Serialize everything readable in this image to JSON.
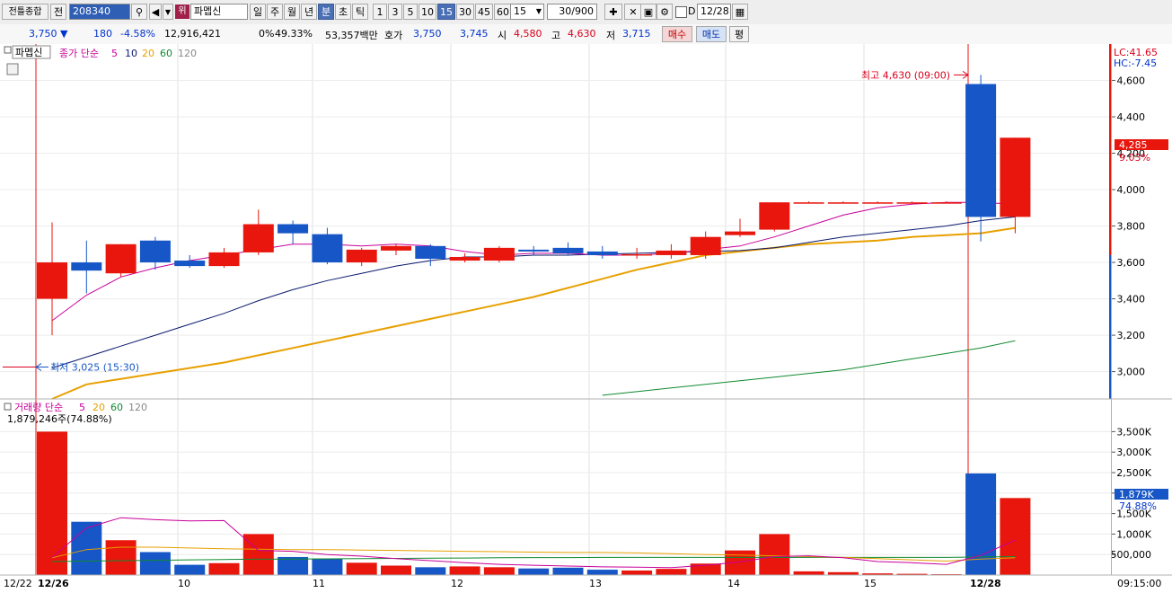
{
  "toolbar": {
    "screen_title": "전틀종합",
    "prev_label": "전",
    "code": "208340",
    "badge": "위",
    "name": "파멥신",
    "periods": [
      "일",
      "주",
      "월",
      "년",
      "분",
      "초",
      "틱"
    ],
    "active_period": "분",
    "intervals": [
      "1",
      "3",
      "5",
      "10",
      "15",
      "30",
      "45",
      "60"
    ],
    "active_interval": "15",
    "interval_select": "15",
    "count": "30/900",
    "checkbox_label": "D",
    "date": "12/28"
  },
  "quote": {
    "price": "3,750",
    "change": "180",
    "change_pct": "-4.58%",
    "volume": "12,916,421",
    "vol_ratio": "0%",
    "turnover_pct": "49.33%",
    "amount": "53,357백만",
    "hoga_label": "호가",
    "ask": "3,750",
    "bid": "3,745",
    "open_label": "시",
    "open": "4,580",
    "high_label": "고",
    "high": "4,630",
    "low_label": "저",
    "low": "3,715",
    "buy_label": "매수",
    "sell_label": "매도",
    "avg_label": "평"
  },
  "price_panel": {
    "name_tag": "파멥신",
    "legend": {
      "prefix": "종가 단순",
      "ma": [
        "5",
        "10",
        "20",
        "60",
        "120"
      ]
    },
    "lc": "LC:41.65",
    "hc": "HC:-7.45",
    "high_marker": "최고 4,630 (09:00)",
    "low_marker": "최저 3,025 (15:30)",
    "current_price": "4,285",
    "current_pct": "9.03%"
  },
  "volume_panel": {
    "legend": {
      "prefix": "거래량 단순",
      "ma": [
        "5",
        "20",
        "60",
        "120"
      ]
    },
    "current_volume": "1,879,246주(74.88%)",
    "current_tag": "1,879K",
    "current_pct": "74.88%"
  },
  "time_axis": {
    "first": "12/22",
    "clock": "09:15:00"
  },
  "colors": {
    "up": "#e8160c",
    "down": "#1656c6",
    "ma5": "#c8009a",
    "ma10": "#0a1a6e",
    "ma20": "#e8a000",
    "ma60": "#108a30"
  },
  "chart_data": {
    "type": "candlestick",
    "y_ticks": [
      "4,600",
      "4,400",
      "4,200",
      "4,000",
      "3,800",
      "3,600",
      "3,400",
      "3,200",
      "3,000"
    ],
    "ylim": [
      2850,
      4780
    ],
    "volume_ticks": [
      "3,500K",
      "3,000K",
      "2,500K",
      "2,000K",
      "1,500K",
      "1,000K",
      "500,000"
    ],
    "volume_ylim": [
      0,
      3750
    ],
    "x_labels": [
      "12/26",
      "10",
      "11",
      "12",
      "13",
      "14",
      "15",
      "12/28"
    ],
    "candles": [
      {
        "o": 3400,
        "h": 3820,
        "l": 3200,
        "c": 3600,
        "v": 3500
      },
      {
        "o": 3600,
        "h": 3720,
        "l": 3430,
        "c": 3555,
        "v": 1300
      },
      {
        "o": 3540,
        "h": 3700,
        "l": 3520,
        "c": 3700,
        "v": 850
      },
      {
        "o": 3720,
        "h": 3740,
        "l": 3560,
        "c": 3600,
        "v": 560
      },
      {
        "o": 3610,
        "h": 3640,
        "l": 3570,
        "c": 3580,
        "v": 250
      },
      {
        "o": 3580,
        "h": 3680,
        "l": 3570,
        "c": 3655,
        "v": 290
      },
      {
        "o": 3655,
        "h": 3890,
        "l": 3640,
        "c": 3810,
        "v": 1000
      },
      {
        "o": 3810,
        "h": 3830,
        "l": 3700,
        "c": 3760,
        "v": 440
      },
      {
        "o": 3755,
        "h": 3790,
        "l": 3590,
        "c": 3600,
        "v": 400
      },
      {
        "o": 3600,
        "h": 3680,
        "l": 3580,
        "c": 3670,
        "v": 300
      },
      {
        "o": 3665,
        "h": 3700,
        "l": 3640,
        "c": 3690,
        "v": 230
      },
      {
        "o": 3690,
        "h": 3700,
        "l": 3580,
        "c": 3620,
        "v": 190
      },
      {
        "o": 3610,
        "h": 3650,
        "l": 3600,
        "c": 3630,
        "v": 210
      },
      {
        "o": 3610,
        "h": 3690,
        "l": 3600,
        "c": 3680,
        "v": 190
      },
      {
        "o": 3670,
        "h": 3690,
        "l": 3640,
        "c": 3660,
        "v": 160
      },
      {
        "o": 3680,
        "h": 3710,
        "l": 3640,
        "c": 3650,
        "v": 180
      },
      {
        "o": 3660,
        "h": 3690,
        "l": 3620,
        "c": 3640,
        "v": 130
      },
      {
        "o": 3640,
        "h": 3680,
        "l": 3620,
        "c": 3645,
        "v": 110
      },
      {
        "o": 3640,
        "h": 3700,
        "l": 3620,
        "c": 3665,
        "v": 150
      },
      {
        "o": 3640,
        "h": 3770,
        "l": 3620,
        "c": 3740,
        "v": 280
      },
      {
        "o": 3750,
        "h": 3840,
        "l": 3740,
        "c": 3770,
        "v": 600
      },
      {
        "o": 3780,
        "h": 3930,
        "l": 3770,
        "c": 3930,
        "v": 1000
      },
      {
        "o": 3930,
        "h": 3935,
        "l": 3925,
        "c": 3930,
        "v": 90
      },
      {
        "o": 3930,
        "h": 3935,
        "l": 3925,
        "c": 3930,
        "v": 70
      },
      {
        "o": 3930,
        "h": 3935,
        "l": 3925,
        "c": 3930,
        "v": 40
      },
      {
        "o": 3930,
        "h": 3935,
        "l": 3925,
        "c": 3930,
        "v": 30
      },
      {
        "o": 3930,
        "h": 3935,
        "l": 3925,
        "c": 3930,
        "v": 20
      },
      {
        "o": 4580,
        "h": 4630,
        "l": 3715,
        "c": 3850,
        "v": 2480
      },
      {
        "o": 3850,
        "h": 4285,
        "l": 3760,
        "c": 4285,
        "v": 1879
      }
    ],
    "ma5": [
      3280,
      3420,
      3520,
      3570,
      3610,
      3640,
      3670,
      3700,
      3700,
      3690,
      3700,
      3690,
      3660,
      3640,
      3650,
      3650,
      3640,
      3640,
      3650,
      3670,
      3690,
      3740,
      3800,
      3860,
      3900,
      3920,
      3930,
      3930,
      3920
    ],
    "ma10": [
      3020,
      3080,
      3140,
      3200,
      3260,
      3320,
      3390,
      3450,
      3500,
      3540,
      3580,
      3610,
      3630,
      3630,
      3640,
      3640,
      3645,
      3650,
      3655,
      3660,
      3665,
      3680,
      3710,
      3740,
      3760,
      3780,
      3800,
      3830,
      3850
    ],
    "ma20": [
      2850,
      2930,
      2960,
      2990,
      3020,
      3050,
      3090,
      3130,
      3170,
      3210,
      3250,
      3290,
      3330,
      3370,
      3410,
      3460,
      3510,
      3560,
      3600,
      3640,
      3660,
      3680,
      3700,
      3710,
      3720,
      3740,
      3750,
      3760,
      3790
    ],
    "ma60": [
      null,
      null,
      null,
      null,
      null,
      null,
      null,
      null,
      null,
      null,
      null,
      null,
      null,
      null,
      null,
      null,
      2870,
      2890,
      2910,
      2930,
      2950,
      2970,
      2990,
      3010,
      3040,
      3070,
      3100,
      3130,
      3170
    ],
    "vol_ma5": [
      430,
      1150,
      1400,
      1350,
      1320,
      1330,
      600,
      580,
      500,
      460,
      400,
      350,
      300,
      260,
      240,
      220,
      200,
      190,
      180,
      240,
      320,
      450,
      470,
      420,
      330,
      300,
      260,
      480,
      850
    ],
    "vol_ma20": [
      420,
      620,
      680,
      680,
      660,
      640,
      630,
      620,
      620,
      610,
      600,
      590,
      580,
      570,
      560,
      550,
      550,
      540,
      520,
      500,
      490,
      470,
      450,
      430,
      400,
      370,
      340,
      390,
      420
    ],
    "vol_ma60": [
      330,
      340,
      350,
      360,
      370,
      380,
      385,
      390,
      395,
      400,
      405,
      410,
      415,
      420,
      425,
      425,
      430,
      430,
      430,
      430,
      430,
      430,
      430,
      430,
      430,
      430,
      430,
      440,
      450
    ]
  }
}
